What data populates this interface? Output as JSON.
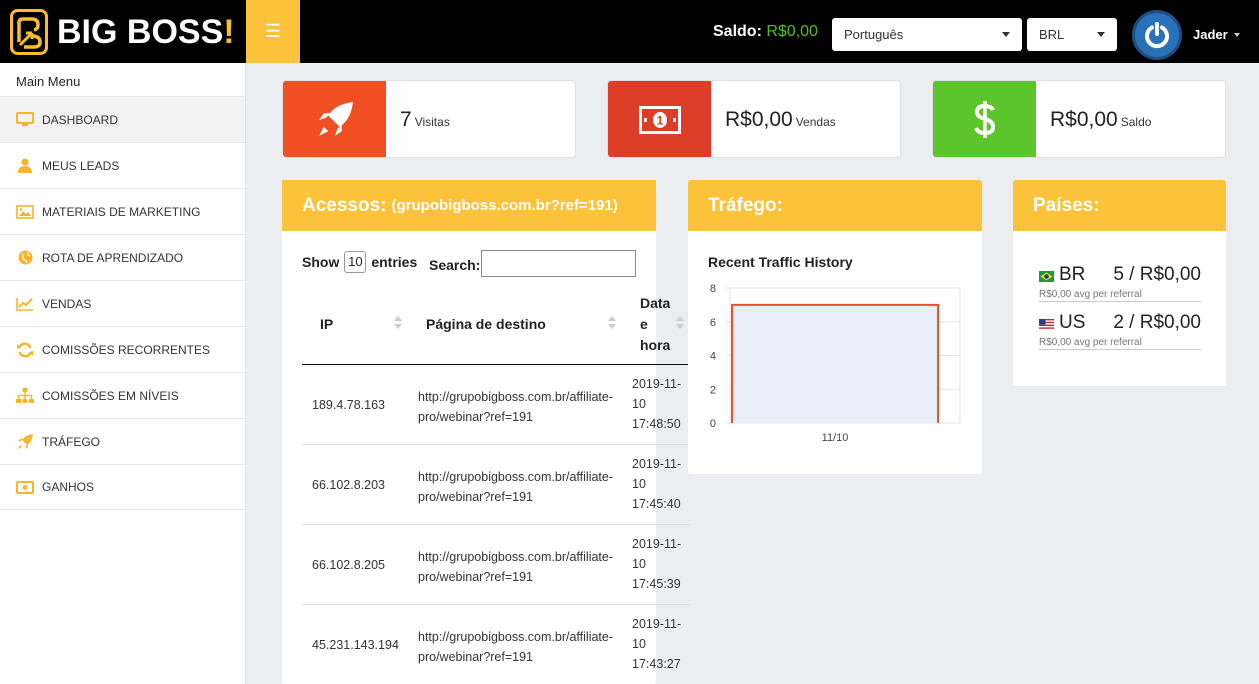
{
  "brand": {
    "name": "BIG BOSS",
    "bang": "!"
  },
  "header": {
    "saldo_label": "Saldo:",
    "saldo_value": "R$0,00",
    "language": "Português",
    "currency": "BRL",
    "user_name": "Jader"
  },
  "sidebar": {
    "title": "Main Menu",
    "items": [
      {
        "label": "DASHBOARD",
        "icon": "monitor-icon"
      },
      {
        "label": "MEUS LEADS",
        "icon": "user-icon"
      },
      {
        "label": "MATERIAIS DE MARKETING",
        "icon": "image-icon"
      },
      {
        "label": "ROTA DE APRENDIZADO",
        "icon": "globe-icon"
      },
      {
        "label": "VENDAS",
        "icon": "line-chart-icon"
      },
      {
        "label": "COMISSÕES RECORRENTES",
        "icon": "refresh-icon"
      },
      {
        "label": "COMISSÕES EM NÍVEIS",
        "icon": "sitemap-icon"
      },
      {
        "label": "TRÁFEGO",
        "icon": "rocket-icon"
      },
      {
        "label": "GANHOS",
        "icon": "money-icon"
      }
    ]
  },
  "stats": [
    {
      "value": "7",
      "label": "Visitas",
      "icon": "rocket-icon",
      "color": "#f04e23"
    },
    {
      "value": "R$0,00",
      "label": "Vendas",
      "icon": "money-bill-icon",
      "color": "#dd3c27"
    },
    {
      "value": "R$0,00",
      "label": "Saldo",
      "icon": "dollar-icon",
      "color": "#5cc52c"
    }
  ],
  "acessos": {
    "title": "Acessos:",
    "subtitle": "(grupobigboss.com.br?ref=191)",
    "show_label": "Show",
    "entries_value": "10",
    "entries_label": "entries",
    "search_label": "Search:",
    "columns": [
      "IP",
      "Página de destino",
      "Data e hora"
    ],
    "rows": [
      {
        "ip": "189.4.78.163",
        "url": "http://grupobigboss.com.br/affiliate-pro/webinar?ref=191",
        "datetime": "2019-11-10 17:48:50"
      },
      {
        "ip": "66.102.8.203",
        "url": "http://grupobigboss.com.br/affiliate-pro/webinar?ref=191",
        "datetime": "2019-11-10 17:45:40"
      },
      {
        "ip": "66.102.8.205",
        "url": "http://grupobigboss.com.br/affiliate-pro/webinar?ref=191",
        "datetime": "2019-11-10 17:45:39"
      },
      {
        "ip": "45.231.143.194",
        "url": "http://grupobigboss.com.br/affiliate-pro/webinar?ref=191",
        "datetime": "2019-11-10 17:43:27"
      }
    ]
  },
  "trafego": {
    "title": "Tráfego:",
    "chart_title": "Recent Traffic History"
  },
  "paises": {
    "title": "Países:",
    "items": [
      {
        "code": "BR",
        "value": "5 / R$0,00",
        "avg": "R$0,00 avg per referral"
      },
      {
        "code": "US",
        "value": "2 / R$0,00",
        "avg": "R$0,00 avg per referral"
      }
    ]
  },
  "chart_data": {
    "type": "area",
    "title": "Recent Traffic History",
    "categories": [
      "11/10"
    ],
    "values": [
      7
    ],
    "yticks": [
      0,
      2,
      4,
      6,
      8
    ],
    "ylim": [
      0,
      8
    ],
    "grid": true,
    "line_color": "#e8532b",
    "fill_color": "#e8eef8"
  }
}
